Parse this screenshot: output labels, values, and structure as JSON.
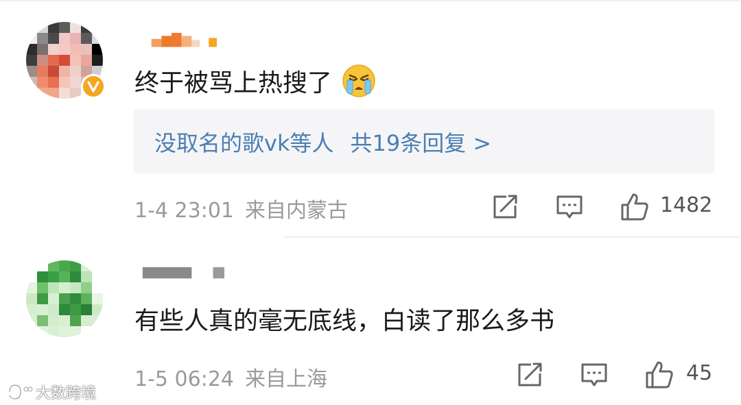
{
  "comments": [
    {
      "text": "终于被骂上热搜了",
      "emoji": "crying-face",
      "reply_box": {
        "names": "没取名的歌vk等人",
        "summary": "共19条回复 >"
      },
      "date": "1-4 23:01",
      "location": "来自内蒙古",
      "likes": "1482",
      "verified": true
    },
    {
      "text": "有些人真的毫无底线，白读了那么多书",
      "date": "1-5 06:24",
      "location": "来自上海",
      "likes": "45",
      "verified": false
    }
  ],
  "icons": {
    "share": "share-icon",
    "comment": "comment-icon",
    "like": "thumbs-up-icon",
    "verified": "verified-v-icon"
  },
  "colors": {
    "reply_link": "#4a7eb4",
    "meta_text": "#9a9a9a",
    "badge": "#f5a623",
    "reply_bg": "#f5f5f7"
  },
  "watermark": {
    "text": "大数跨境"
  }
}
